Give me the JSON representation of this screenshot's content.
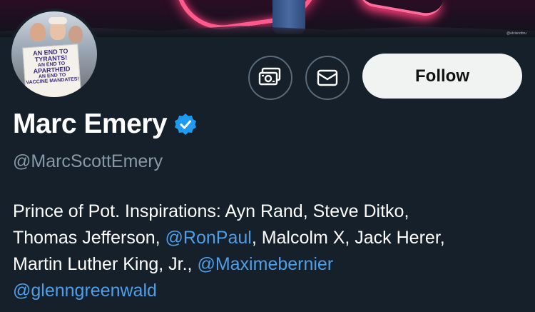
{
  "banner": {
    "credit": "@elvisnobru"
  },
  "avatar": {
    "sign_lines": [
      "AN END TO",
      "TYRANTS!",
      "AN END TO",
      "APARTHEID",
      "AN END TO",
      "VACCINE MANDATES!"
    ]
  },
  "actions": {
    "tip_icon": "money-icon",
    "message_icon": "envelope-icon",
    "follow_label": "Follow"
  },
  "profile": {
    "name": "Marc Emery",
    "verified_icon": "verified-badge-icon",
    "handle": "@MarcScottEmery",
    "bio": {
      "t1": "Prince of Pot. Inspirations: Ayn Rand, Steve Ditko,",
      "t2": "Thomas Jefferson, ",
      "m1": "@RonPaul",
      "t3": ", Malcolm X, Jack Herer,",
      "t4": "Martin Luther King, Jr., ",
      "m2": "@Maximebernier",
      "m3": "@glenngreenwald"
    }
  },
  "colors": {
    "background": "#15202b",
    "link": "#4f9ee8",
    "muted": "#8899a6",
    "verified": "#1d9bf0"
  }
}
